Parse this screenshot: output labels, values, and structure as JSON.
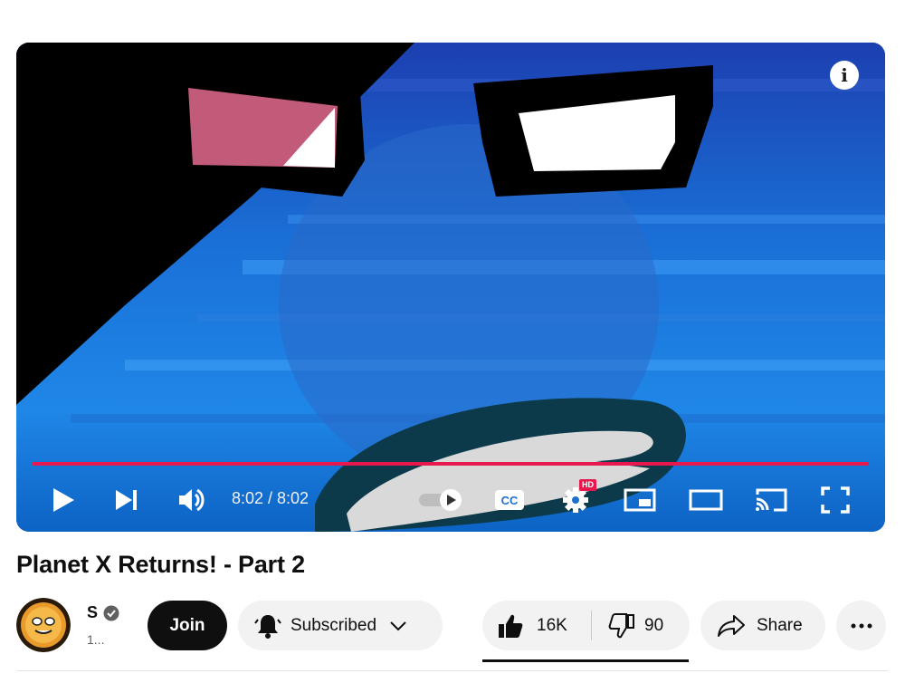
{
  "player": {
    "time_display": "8:02 / 8:02",
    "progress_fraction": 1.0,
    "hd_badge": "HD",
    "icons": {
      "info": "info-icon",
      "play": "play-icon",
      "next": "next-icon",
      "volume": "volume-icon",
      "autoplay": "autoplay-toggle-icon",
      "captions": "captions-icon",
      "settings": "gear-icon",
      "miniplayer": "miniplayer-icon",
      "theater": "theater-mode-icon",
      "cast": "cast-icon",
      "fullscreen": "fullscreen-icon"
    },
    "captions_label": "CC",
    "accent_color": "#e8174d"
  },
  "video": {
    "title": "Planet X Returns! - Part 2"
  },
  "channel": {
    "name": "S",
    "subscribers": "1..."
  },
  "actions": {
    "join_label": "Join",
    "subscribed_label": "Subscribed",
    "like_count": "16K",
    "dislike_count": "90",
    "share_label": "Share"
  }
}
